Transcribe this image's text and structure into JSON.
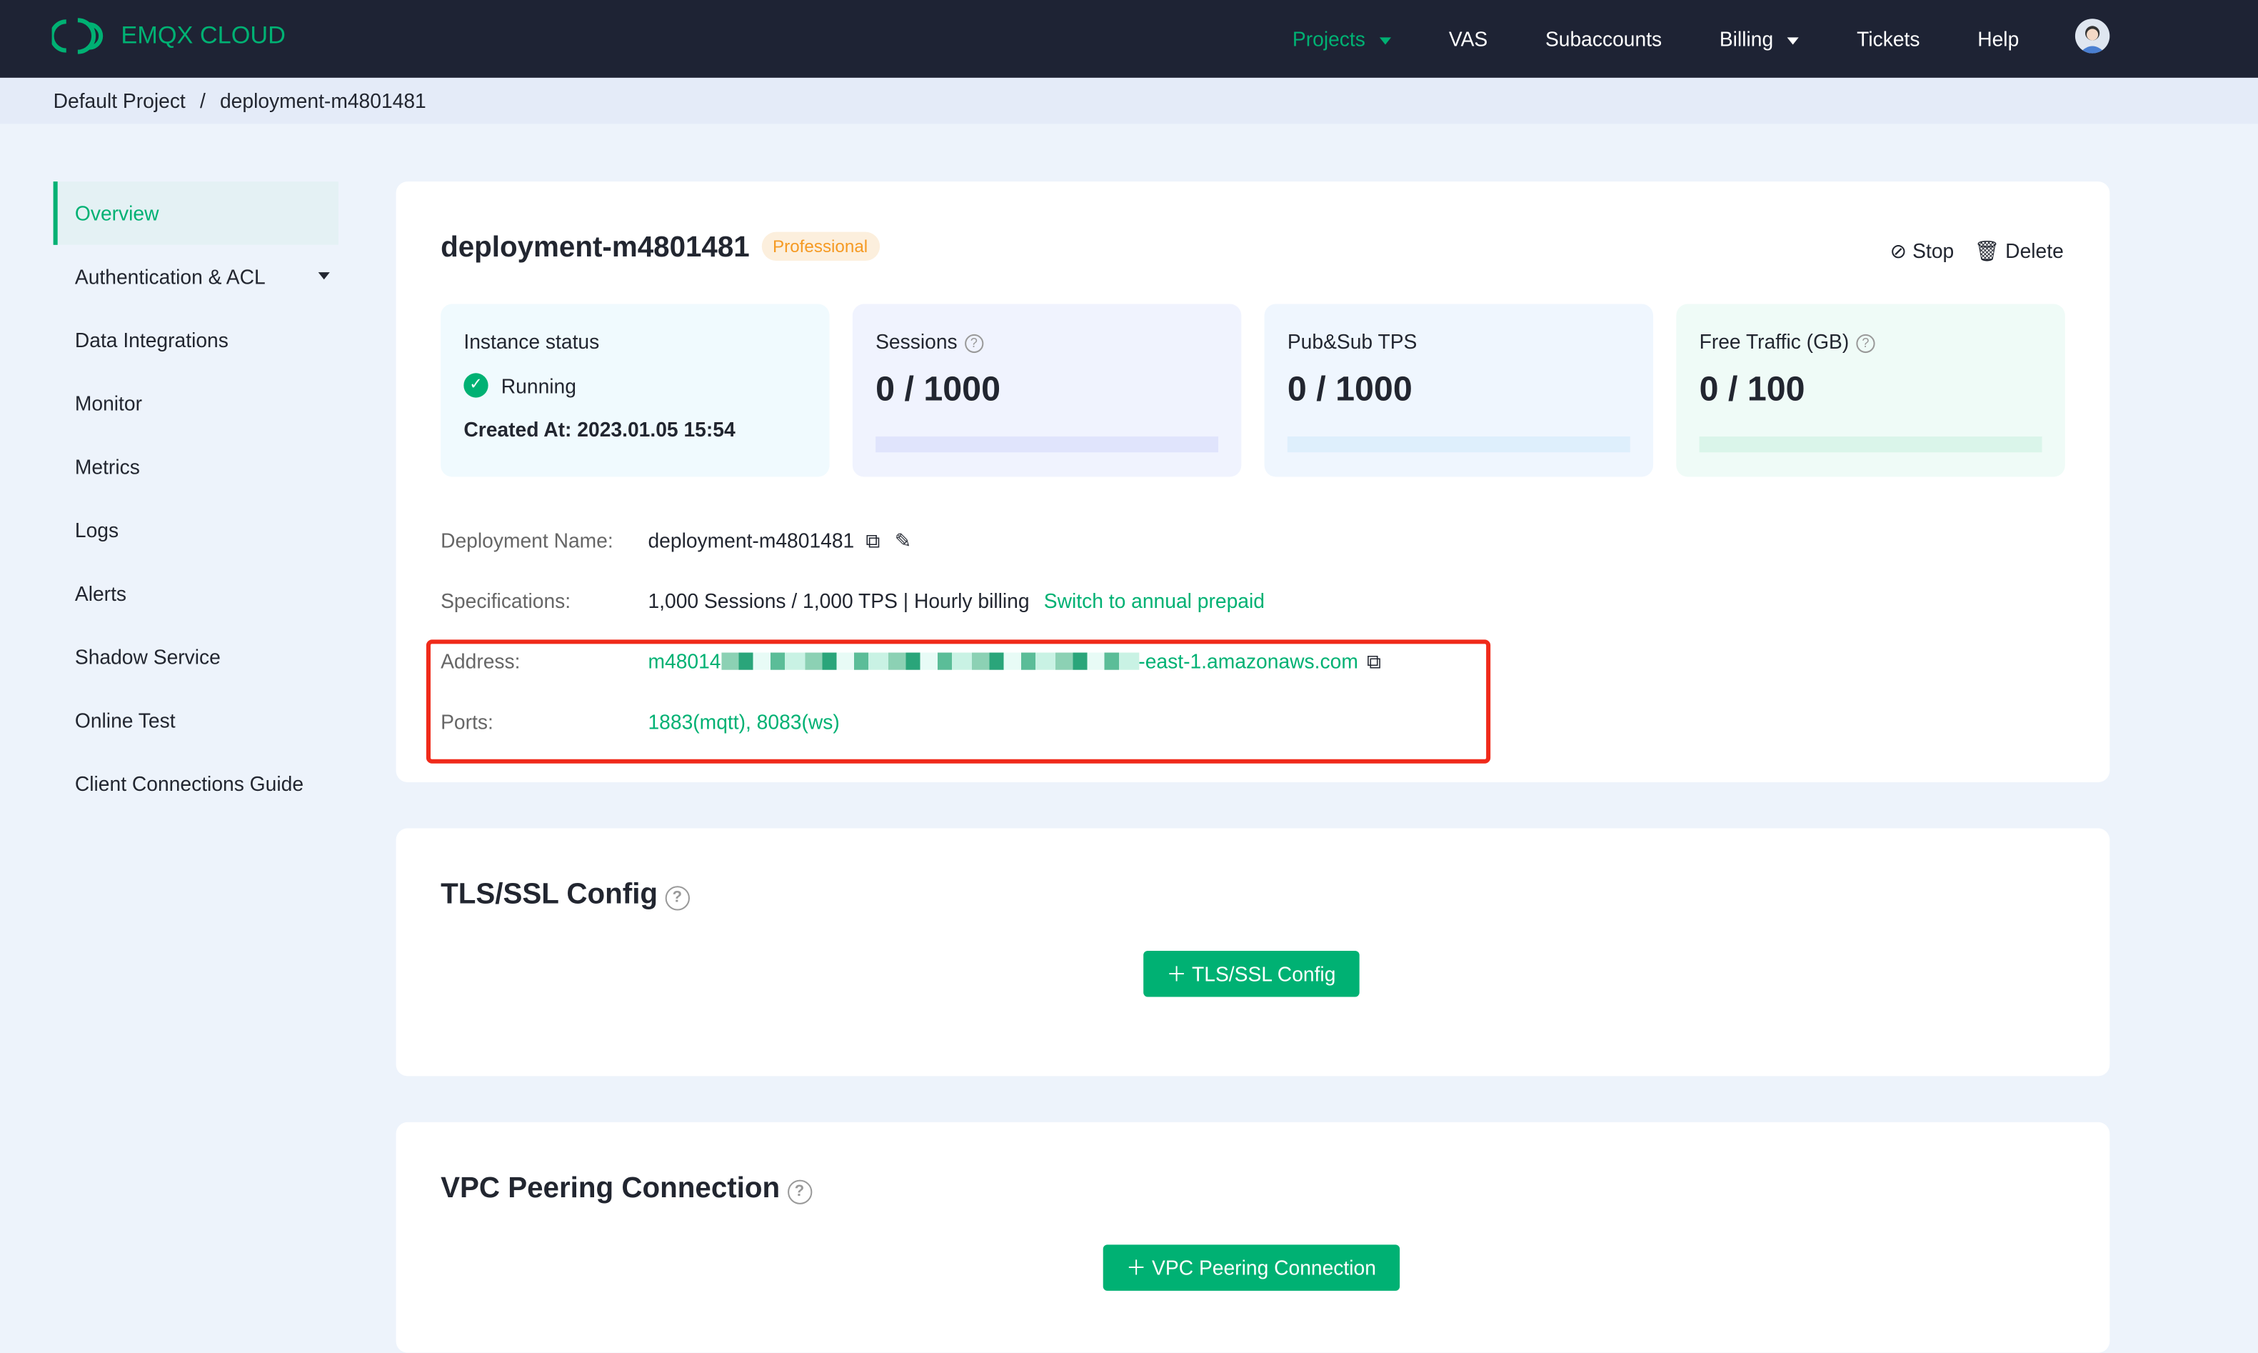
{
  "header": {
    "brand": "EMQX CLOUD",
    "nav": [
      {
        "label": "Projects",
        "active": true,
        "dropdown": true
      },
      {
        "label": "VAS"
      },
      {
        "label": "Subaccounts"
      },
      {
        "label": "Billing",
        "dropdown": true
      },
      {
        "label": "Tickets"
      },
      {
        "label": "Help"
      }
    ]
  },
  "breadcrumb": [
    "Default Project",
    "deployment-m4801481"
  ],
  "sidebar": {
    "items": [
      {
        "label": "Overview",
        "active": true
      },
      {
        "label": "Authentication & ACL"
      },
      {
        "label": "Data Integrations"
      },
      {
        "label": "Monitor"
      },
      {
        "label": "Metrics"
      },
      {
        "label": "Logs"
      },
      {
        "label": "Alerts"
      },
      {
        "label": "Shadow Service"
      },
      {
        "label": "Online Test"
      },
      {
        "label": "Client Connections Guide"
      }
    ]
  },
  "overview": {
    "title": "deployment-m4801481",
    "badge": "Professional",
    "stop": "Stop",
    "delete": "Delete",
    "stats": [
      {
        "label": "Instance status",
        "status": "Running",
        "created": "Created At: 2023.01.05 15:54"
      },
      {
        "label": "Sessions",
        "value": "0 / 1000",
        "progress": 0
      },
      {
        "label": "Pub&Sub TPS",
        "value": "0 / 1000",
        "progress": 0
      },
      {
        "label": "Free Traffic (GB)",
        "value": "0 / 100",
        "progress": 0
      }
    ],
    "name_label": "Deployment Name:",
    "name_value": "deployment-m4801481",
    "spec_label": "Specifications:",
    "spec_value": "1,000 Sessions / 1,000 TPS | Hourly billing",
    "spec_link": "Switch to annual prepaid",
    "address_label": "Address:",
    "address_prefix": "m48014",
    "address_suffix": "-east-1.amazonaws.com",
    "ports_label": "Ports:",
    "ports_value": "1883(mqtt), 8083(ws)"
  },
  "tls": {
    "title": "TLS/SSL Config",
    "button": "TLS/SSL Config"
  },
  "vpc": {
    "title": "VPC Peering Connection",
    "button": "VPC Peering Connection"
  },
  "colors": {
    "accent": "#00b173",
    "header": "#1e2334",
    "highlight": "#f02a1a",
    "badge": "#f59a23"
  }
}
